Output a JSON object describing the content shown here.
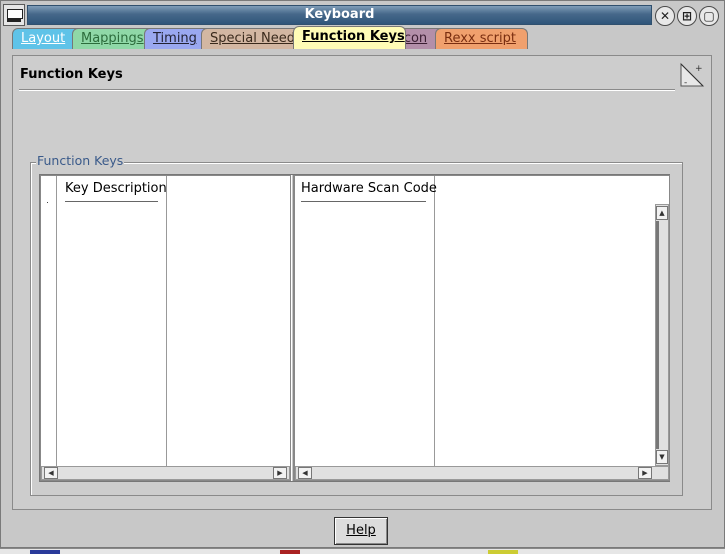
{
  "window": {
    "title": "Keyboard"
  },
  "tabs": [
    {
      "label": "Layout"
    },
    {
      "label": "Mappings"
    },
    {
      "label": "Timing"
    },
    {
      "label": "Special Needs"
    },
    {
      "label": "Function Keys",
      "selected": true
    },
    {
      "label": "Icon"
    },
    {
      "label": "Rexx script"
    }
  ],
  "page": {
    "title": "Function Keys",
    "group_label": "Function Keys",
    "left_table": {
      "columns": [
        "Key Description"
      ]
    },
    "right_table": {
      "columns": [
        "Hardware Scan Code"
      ]
    }
  },
  "footer": {
    "help_label": "Help"
  },
  "title_buttons": [
    "close-icon",
    "maximize-icon",
    "minimize-icon"
  ]
}
